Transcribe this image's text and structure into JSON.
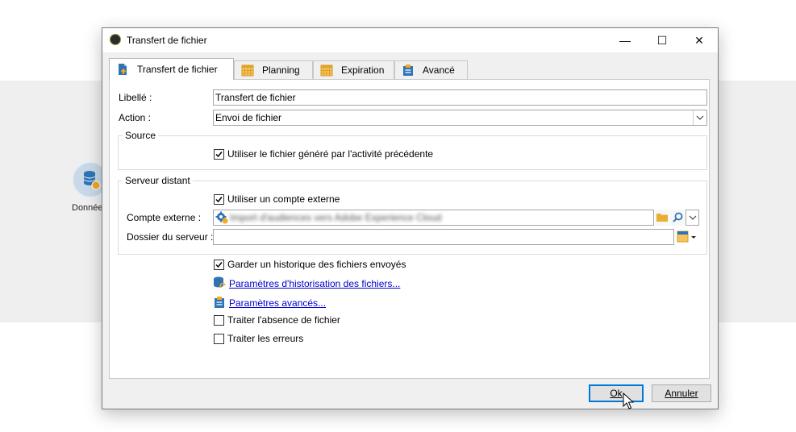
{
  "background": {
    "node_label": "Donnée"
  },
  "dialog": {
    "title": "Transfert de fichier",
    "window_controls": {
      "minimize": "—",
      "maximize": "☐",
      "close": "✕"
    },
    "tabs": [
      {
        "label": "Transfert de fichier",
        "icon": "file-transfer-icon",
        "active": true
      },
      {
        "label": "Planning",
        "icon": "calendar-icon",
        "active": false
      },
      {
        "label": "Expiration",
        "icon": "calendar-icon",
        "active": false
      },
      {
        "label": "Avancé",
        "icon": "clipboard-icon",
        "active": false
      }
    ],
    "form": {
      "libelle_label": "Libellé :",
      "libelle_value": "Transfert de fichier",
      "action_label": "Action :",
      "action_value": "Envoi de fichier",
      "source_title": "Source",
      "source_checkbox_label": "Utiliser le fichier généré par l'activité précédente",
      "source_checkbox_checked": true,
      "remote_title": "Serveur distant",
      "external_account_checkbox_label": "Utiliser un compte externe",
      "external_account_checkbox_checked": true,
      "external_account_label": "Compte externe :",
      "external_account_value": "Import d'audiences vers Adobe Experience Cloud",
      "server_folder_label": "Dossier du serveur :",
      "server_folder_value": "",
      "history_checkbox_label": "Garder un historique des fichiers envoyés",
      "history_checkbox_checked": true,
      "history_params_link": "Paramètres d'historisation des fichiers...",
      "advanced_params_link": "Paramètres avancés...",
      "missing_file_checkbox_label": "Traiter l'absence de fichier",
      "missing_file_checkbox_checked": false,
      "errors_checkbox_label": "Traiter les erreurs",
      "errors_checkbox_checked": false
    },
    "buttons": {
      "ok": "Ok",
      "cancel": "Annuler"
    }
  },
  "colors": {
    "link": "#0000cc",
    "primary_border": "#0078d7",
    "icon_blue": "#2e74b5",
    "icon_orange": "#f5a623"
  }
}
